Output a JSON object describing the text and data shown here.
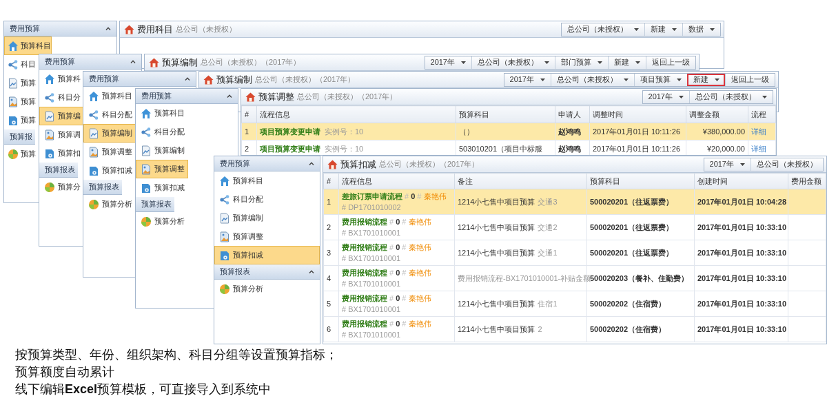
{
  "windows": [
    {
      "sidebar": {
        "groups": [
          {
            "title": "费用预算",
            "expanded": true,
            "items": [
              {
                "label": "预算科目",
                "selected": true
              },
              {
                "label": "科目",
                "selected": false
              },
              {
                "label": "预算",
                "selected": false
              },
              {
                "label": "预算",
                "selected": false
              },
              {
                "label": "预算",
                "selected": false
              }
            ]
          },
          {
            "title": "预算报",
            "items": [
              {
                "label": "预算",
                "selected": false
              }
            ]
          }
        ]
      },
      "main": {
        "title": "费用科目",
        "subtitle": "总公司（未授权）",
        "buttons": [
          {
            "label": "总公司（未授权）",
            "dropdown": true,
            "highlighted": false
          },
          {
            "label": "新建",
            "dropdown": true,
            "highlighted": false
          },
          {
            "label": "数据",
            "dropdown": true,
            "highlighted": false
          }
        ]
      }
    },
    {
      "sidebar": {
        "groups": [
          {
            "title": "费用预算",
            "expanded": true,
            "items": [
              {
                "label": "预算科",
                "selected": false
              },
              {
                "label": "科目分",
                "selected": false
              },
              {
                "label": "预算编",
                "selected": true
              },
              {
                "label": "预算调",
                "selected": false
              },
              {
                "label": "预算扣",
                "selected": false
              }
            ]
          },
          {
            "title": "预算报表",
            "items": [
              {
                "label": "预算分",
                "selected": false
              }
            ]
          }
        ]
      },
      "main": {
        "title": "预算编制",
        "subtitle": "总公司（未授权）（2017年）",
        "buttons": [
          {
            "label": "2017年",
            "dropdown": true,
            "highlighted": false
          },
          {
            "label": "总公司（未授权）",
            "dropdown": true,
            "highlighted": false
          },
          {
            "label": "部门预算",
            "dropdown": true,
            "highlighted": false
          },
          {
            "label": "新建",
            "dropdown": true,
            "highlighted": false
          },
          {
            "label": "返回上一级",
            "dropdown": false,
            "highlighted": false
          }
        ]
      }
    },
    {
      "sidebar": {
        "groups": [
          {
            "title": "费用预算",
            "expanded": true,
            "items": [
              {
                "label": "预算科目",
                "selected": false
              },
              {
                "label": "科目分配",
                "selected": false
              },
              {
                "label": "预算编制",
                "selected": true
              },
              {
                "label": "预算调整",
                "selected": false
              },
              {
                "label": "预算扣减",
                "selected": false
              }
            ]
          },
          {
            "title": "预算报表",
            "items": [
              {
                "label": "预算分析",
                "selected": false
              }
            ]
          }
        ]
      },
      "main": {
        "title": "预算编制",
        "subtitle": "总公司（未授权）（2017年）",
        "buttons": [
          {
            "label": "2017年",
            "dropdown": true,
            "highlighted": false
          },
          {
            "label": "总公司（未授权）",
            "dropdown": true,
            "highlighted": false
          },
          {
            "label": "项目预算",
            "dropdown": true,
            "highlighted": false
          },
          {
            "label": "新建",
            "dropdown": true,
            "highlighted": true
          },
          {
            "label": "返回上一级",
            "dropdown": false,
            "highlighted": false
          }
        ]
      }
    },
    {
      "sidebar": {
        "groups": [
          {
            "title": "费用预算",
            "expanded": true,
            "items": [
              {
                "label": "预算科目",
                "selected": false
              },
              {
                "label": "科目分配",
                "selected": false
              },
              {
                "label": "预算编制",
                "selected": false
              },
              {
                "label": "预算调整",
                "selected": true
              },
              {
                "label": "预算扣减",
                "selected": false
              }
            ]
          },
          {
            "title": "预算报表",
            "items": [
              {
                "label": "预算分析",
                "selected": false
              }
            ]
          }
        ]
      },
      "main": {
        "title": "预算调整",
        "subtitle": "总公司（未授权）（2017年）",
        "buttons": [
          {
            "label": "2017年",
            "dropdown": true,
            "highlighted": false
          },
          {
            "label": "总公司（未授权）",
            "dropdown": true,
            "highlighted": false
          }
        ],
        "table": {
          "kind": "adjustment",
          "columns": [
            "#",
            "流程信息",
            "预算科目",
            "申请人",
            "调整时间",
            "调整金额",
            "流程"
          ],
          "rows": [
            {
              "no": "1",
              "flow": "项目预算变更申请",
              "instance": "实例号：10",
              "item": "（）",
              "applicant": "赵鸿鸣",
              "time": "2017年01月01日 10:11:26",
              "amount": "¥380,000.00",
              "link": "详细",
              "selected": true
            },
            {
              "no": "2",
              "flow": "项目预算变更申请",
              "instance": "实例号：10",
              "item": "503010201（项目中标服",
              "applicant": "赵鸿鸣",
              "time": "2017年01月01日 10:11:26",
              "amount": "¥20,000.00",
              "link": "详细",
              "selected": false
            }
          ]
        }
      }
    },
    {
      "sidebar": {
        "groups": [
          {
            "title": "费用预算",
            "expanded": true,
            "items": [
              {
                "label": "预算科目",
                "selected": false
              },
              {
                "label": "科目分配",
                "selected": false
              },
              {
                "label": "预算编制",
                "selected": false
              },
              {
                "label": "预算调整",
                "selected": false
              },
              {
                "label": "预算扣减",
                "selected": true
              }
            ]
          },
          {
            "title": "预算报表",
            "expanded": true,
            "items": [
              {
                "label": "预算分析",
                "selected": false
              }
            ]
          }
        ]
      },
      "main": {
        "title": "预算扣减",
        "subtitle": "总公司（未授权）（2017年）",
        "buttons": [
          {
            "label": "2017年",
            "dropdown": true,
            "highlighted": false
          },
          {
            "label": "总公司（未授权）",
            "dropdown": false,
            "highlighted": false
          }
        ],
        "table": {
          "kind": "deduction",
          "columns": [
            "#",
            "流程信息",
            "备注",
            "预算科目",
            "创建时间",
            "费用金额"
          ],
          "rows": [
            {
              "no": "1",
              "process": "差旅订票申请流程",
              "count": "# **0** #",
              "person": "秦艳伟",
              "number": "# DP1701010002",
              "note": "1214小七售中项目预算",
              "note_tag": "交通3",
              "item": "500020201（往返票费）",
              "time": "2017年01月01日 10:04:28",
              "selected": true
            },
            {
              "no": "2",
              "process": "费用报销流程",
              "count": "# **0** #",
              "person": "秦艳伟",
              "number": "# BX1701010001",
              "note": "1214小七售中项目预算",
              "note_tag": "交通2",
              "item": "500020201（往返票费）",
              "time": "2017年01月01日 10:33:10",
              "selected": false
            },
            {
              "no": "3",
              "process": "费用报销流程",
              "count": "# **0** #",
              "person": "秦艳伟",
              "number": "# BX1701010001",
              "note": "1214小七售中项目预算",
              "note_tag": "交通1",
              "item": "500020201（往返票费）",
              "time": "2017年01月01日 10:33:10",
              "selected": false
            },
            {
              "no": "4",
              "process": "费用报销流程",
              "count": "# **0** #",
              "person": "秦艳伟",
              "number": "# BX1701010001",
              "note_tag": "费用报销流程-BX1701010001-补贴金额",
              "item": "500020203（餐补、住勤费）",
              "time": "2017年01月01日 10:33:10",
              "selected": false
            },
            {
              "no": "5",
              "process": "费用报销流程",
              "count": "# **0** #",
              "person": "秦艳伟",
              "number": "# BX1701010001",
              "note": "1214小七售中项目预算",
              "note_tag": "住宿1",
              "item": "500020202（住宿费）",
              "time": "2017年01月01日 10:33:10",
              "selected": false
            },
            {
              "no": "6",
              "process": "费用报销流程",
              "count": "# **0** #",
              "person": "秦艳伟",
              "number": "# BX1701010001",
              "note": "1214小七售中项目预算",
              "note_tag": "2",
              "item": "500020202（住宿费）",
              "time": "2017年01月01日 10:33:10",
              "selected": false
            }
          ]
        }
      }
    }
  ],
  "caption": [
    "按预算类型、年份、组织架构、科目分组等设置预算指标；",
    "预算额度自动累计",
    "线下编辑**Excel**预算模板，可直接导入到系统中"
  ]
}
